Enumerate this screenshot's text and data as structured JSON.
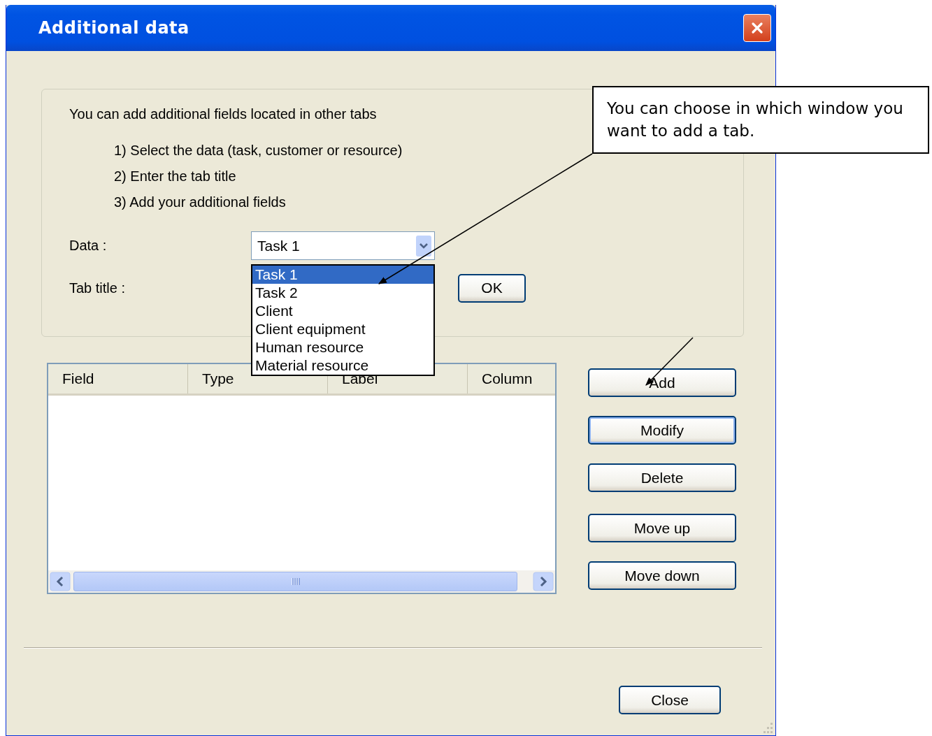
{
  "window": {
    "title": "Additional data"
  },
  "instructions": {
    "intro": "You can add additional fields located in other tabs",
    "steps": [
      "1) Select the data (task, customer or resource)",
      "2) Enter the tab title",
      "3) Add your additional fields"
    ]
  },
  "data_field": {
    "label": "Data :",
    "value": "Task 1",
    "expanded": true,
    "options": [
      {
        "label": "Task 1",
        "selected": true
      },
      {
        "label": "Task 2",
        "selected": false
      },
      {
        "label": "Client",
        "selected": false
      },
      {
        "label": "Client equipment",
        "selected": false
      },
      {
        "label": "Human resource",
        "selected": false
      },
      {
        "label": "Material resource",
        "selected": false
      }
    ]
  },
  "tab_title": {
    "label": "Tab title :"
  },
  "ok_button": {
    "label": "OK"
  },
  "table": {
    "columns": [
      "Field",
      "Type",
      "Label",
      "Column"
    ]
  },
  "side_buttons": [
    {
      "label": "Add",
      "focused": false
    },
    {
      "label": "Modify",
      "focused": true
    },
    {
      "label": "Delete",
      "focused": false
    },
    {
      "label": "Move up",
      "focused": false
    },
    {
      "label": "Move down",
      "focused": false
    }
  ],
  "close_button": {
    "label": "Close"
  },
  "callout": {
    "text": "You can choose in which window you want to add a tab."
  }
}
